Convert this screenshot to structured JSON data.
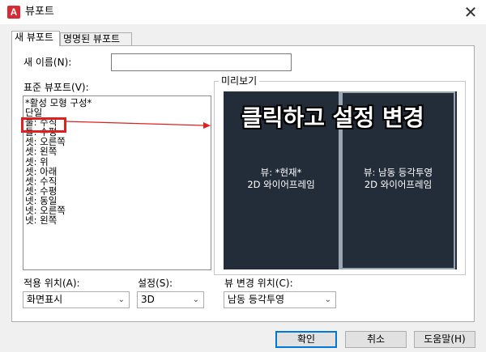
{
  "window": {
    "title": "뷰포트",
    "app_icon_letter": "A",
    "close_glyph": "✕"
  },
  "tabs": [
    {
      "label": "새 뷰포트",
      "active": true
    },
    {
      "label": "명명된 뷰포트",
      "active": false
    }
  ],
  "new_name": {
    "label": "새 이름(N):",
    "value": ""
  },
  "standard_viewports": {
    "label": "표준 뷰포트(V):",
    "items": [
      "*활성 모형 구성*",
      "단일",
      "둘: 수직",
      "둘: 수평",
      "셋: 오른쪽",
      "셋: 왼쪽",
      "셋: 위",
      "셋: 아래",
      "셋: 수직",
      "셋: 수평",
      "넷: 동일",
      "넷: 오른쪽",
      "넷: 왼쪽"
    ]
  },
  "preview": {
    "label": "미리보기",
    "overlay_text": "클릭하고 설정 변경",
    "left_pane": {
      "line1": "뷰: *현재*",
      "line2": "2D 와이어프레임"
    },
    "right_pane": {
      "line1": "뷰: 남동 등각투영",
      "line2": "2D 와이어프레임"
    }
  },
  "apply_to": {
    "label": "적용 위치(A):",
    "value": "화면표시"
  },
  "setup": {
    "label": "설정(S):",
    "value": "3D"
  },
  "change_view": {
    "label": "뷰 변경 위치(C):",
    "value": "남동 등각투영"
  },
  "buttons": {
    "ok": "확인",
    "cancel": "취소",
    "help": "도움말(H)"
  },
  "colors": {
    "preview_bg": "#232d3a",
    "highlight": "#e02020",
    "accent": "#0078d7"
  }
}
